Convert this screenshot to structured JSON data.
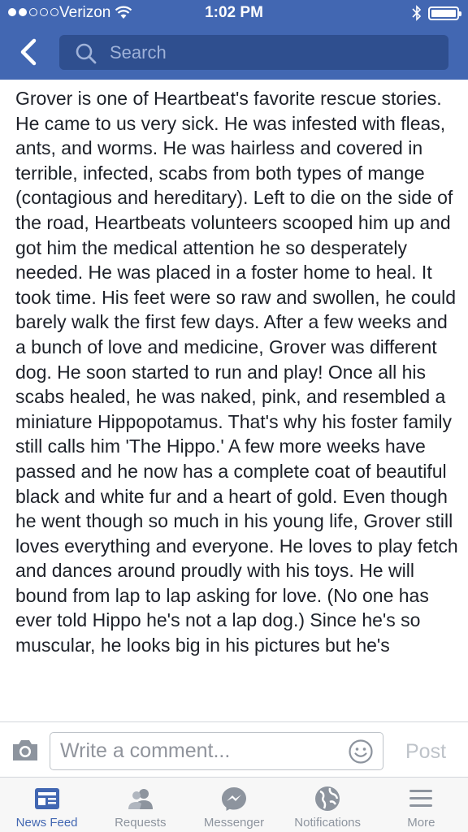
{
  "status_bar": {
    "carrier": "Verizon",
    "time": "1:02 PM"
  },
  "header": {
    "search_placeholder": "Search"
  },
  "post": {
    "body": "Grover is one of Heartbeat's favorite rescue stories. He came to us very sick. He was infested with fleas, ants, and worms. He was hairless and covered in terrible, infected, scabs from both types of mange (contagious and hereditary). Left to die on the side of the road, Heartbeats volunteers scooped him up and got him the medical attention he so desperately needed. He was placed in a foster home to heal. It took time. His feet were so raw and swollen, he could barely walk the first few days. After a few weeks and a bunch of love and medicine, Grover was different dog. He soon started to run and play! Once all his scabs healed, he was naked, pink, and resembled a miniature Hippopotamus. That's why his foster family still calls him 'The Hippo.' A few more weeks have passed and he now has a complete coat of beautiful black and white fur and a heart of gold. Even though he went though so much in his young life, Grover still loves everything and everyone. He loves to play fetch and dances around proudly with his toys. He will bound from lap to lap asking for love. (No one has ever told Hippo he's not a lap dog.) Since he's so muscular, he looks big in his pictures but he's"
  },
  "comment_bar": {
    "placeholder": "Write a comment...",
    "post_label": "Post"
  },
  "tabs": [
    {
      "label": "News Feed",
      "icon": "news-feed-icon",
      "active": true
    },
    {
      "label": "Requests",
      "icon": "friend-requests-icon",
      "active": false
    },
    {
      "label": "Messenger",
      "icon": "messenger-icon",
      "active": false
    },
    {
      "label": "Notifications",
      "icon": "globe-icon",
      "active": false
    },
    {
      "label": "More",
      "icon": "menu-icon",
      "active": false
    }
  ],
  "colors": {
    "brand": "#4267b2",
    "search_bg": "#2f4f8f",
    "tab_inactive": "#8d949e"
  }
}
